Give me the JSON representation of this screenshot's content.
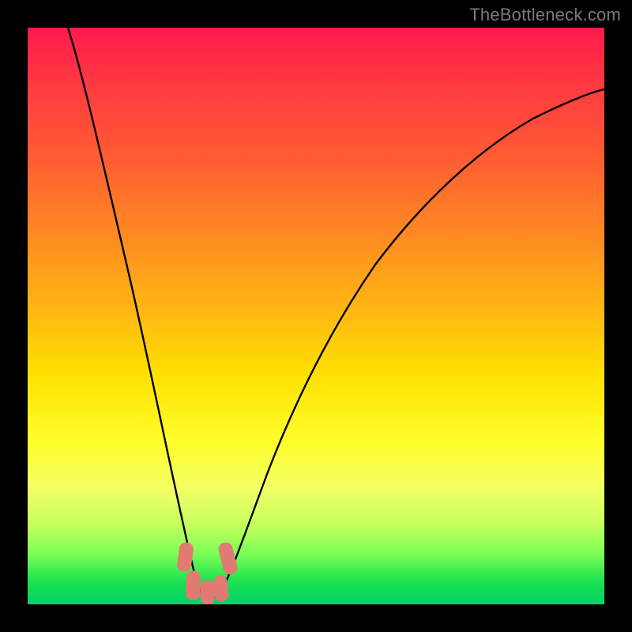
{
  "watermark": "TheBottleneck.com",
  "chart_data": {
    "type": "line",
    "title": "",
    "xlabel": "",
    "ylabel": "",
    "xlim": [
      0,
      100
    ],
    "ylim": [
      0,
      100
    ],
    "grid": false,
    "legend": false,
    "series": [
      {
        "name": "bottleneck-curve",
        "x": [
          7,
          10,
          13,
          16,
          19,
          22,
          25,
          27,
          28.5,
          30,
          31.5,
          33,
          35,
          38,
          42,
          48,
          55,
          63,
          72,
          82,
          92,
          100
        ],
        "y": [
          100,
          83,
          67,
          52,
          38,
          26,
          15,
          8,
          4,
          2,
          2,
          3.5,
          7,
          14,
          24,
          36,
          48,
          59,
          68,
          76,
          82,
          86
        ]
      }
    ],
    "annotations": [
      {
        "name": "valley-markers",
        "x": [
          27,
          28.5,
          30,
          31.5,
          33
        ],
        "y": [
          8,
          4,
          2,
          3.5,
          7
        ]
      }
    ],
    "background_gradient": {
      "top": "#ff1a4d",
      "bottom": "#00d26a",
      "meaning": "red-high / green-low heat band"
    }
  }
}
